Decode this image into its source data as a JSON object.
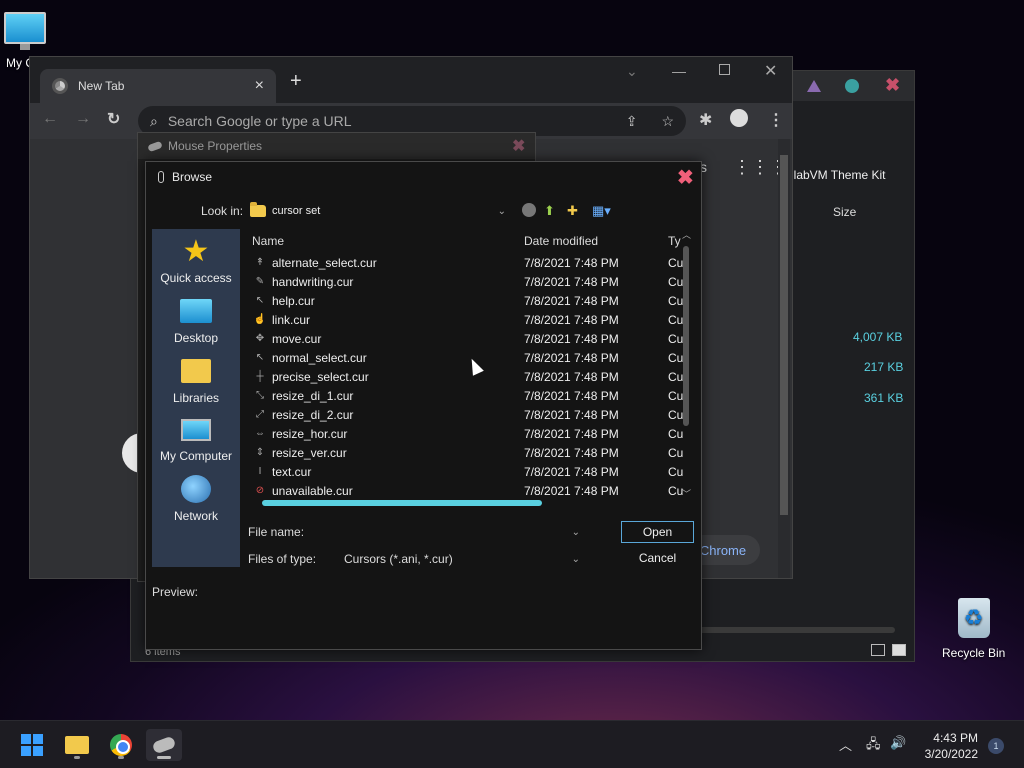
{
  "desktop": {
    "my_computer_label": "My C",
    "recycle_bin_label": "Recycle Bin"
  },
  "explorer_bg": {
    "theme_text": "llabVM Theme Kit",
    "size_header": "Size",
    "sizes": [
      "4,007 KB",
      "217 KB",
      "361 KB"
    ],
    "status": "6 items",
    "chrome_button": "Chrome"
  },
  "chrome": {
    "tab_title": "New Tab",
    "tab_close": "×",
    "new_tab": "+",
    "omnibox_placeholder": "Search Google or type a URL",
    "s_letter": "s"
  },
  "mouse_properties": {
    "title": "Mouse Properties"
  },
  "browse": {
    "title": "Browse",
    "look_in_label": "Look in:",
    "look_in_value": "cursor set",
    "places": [
      "Quick access",
      "Desktop",
      "Libraries",
      "My Computer",
      "Network"
    ],
    "columns": {
      "name": "Name",
      "date": "Date modified",
      "type": "Ty"
    },
    "files": [
      {
        "name": "alternate_select.cur",
        "date": "7/8/2021 7:48 PM",
        "type": "Cu"
      },
      {
        "name": "handwriting.cur",
        "date": "7/8/2021 7:48 PM",
        "type": "Cu"
      },
      {
        "name": "help.cur",
        "date": "7/8/2021 7:48 PM",
        "type": "Cu"
      },
      {
        "name": "link.cur",
        "date": "7/8/2021 7:48 PM",
        "type": "Cu"
      },
      {
        "name": "move.cur",
        "date": "7/8/2021 7:48 PM",
        "type": "Cu"
      },
      {
        "name": "normal_select.cur",
        "date": "7/8/2021 7:48 PM",
        "type": "Cu"
      },
      {
        "name": "precise_select.cur",
        "date": "7/8/2021 7:48 PM",
        "type": "Cu"
      },
      {
        "name": "resize_di_1.cur",
        "date": "7/8/2021 7:48 PM",
        "type": "Cu"
      },
      {
        "name": "resize_di_2.cur",
        "date": "7/8/2021 7:48 PM",
        "type": "Cu"
      },
      {
        "name": "resize_hor.cur",
        "date": "7/8/2021 7:48 PM",
        "type": "Cu"
      },
      {
        "name": "resize_ver.cur",
        "date": "7/8/2021 7:48 PM",
        "type": "Cu"
      },
      {
        "name": "text.cur",
        "date": "7/8/2021 7:48 PM",
        "type": "Cu"
      },
      {
        "name": "unavailable.cur",
        "date": "7/8/2021 7:48 PM",
        "type": "Cu"
      }
    ],
    "file_name_label": "File name:",
    "file_name_value": "",
    "files_of_type_label": "Files of type:",
    "files_of_type_value": "Cursors (*.ani, *.cur)",
    "open_button": "Open",
    "cancel_button": "Cancel",
    "preview_label": "Preview:"
  },
  "taskbar": {
    "time": "4:43 PM",
    "date": "3/20/2022",
    "notification_count": "1"
  },
  "colors": {
    "accent": "#5ad0e0",
    "close_red": "#f0607a",
    "places_bg": "#2e3a4e"
  }
}
